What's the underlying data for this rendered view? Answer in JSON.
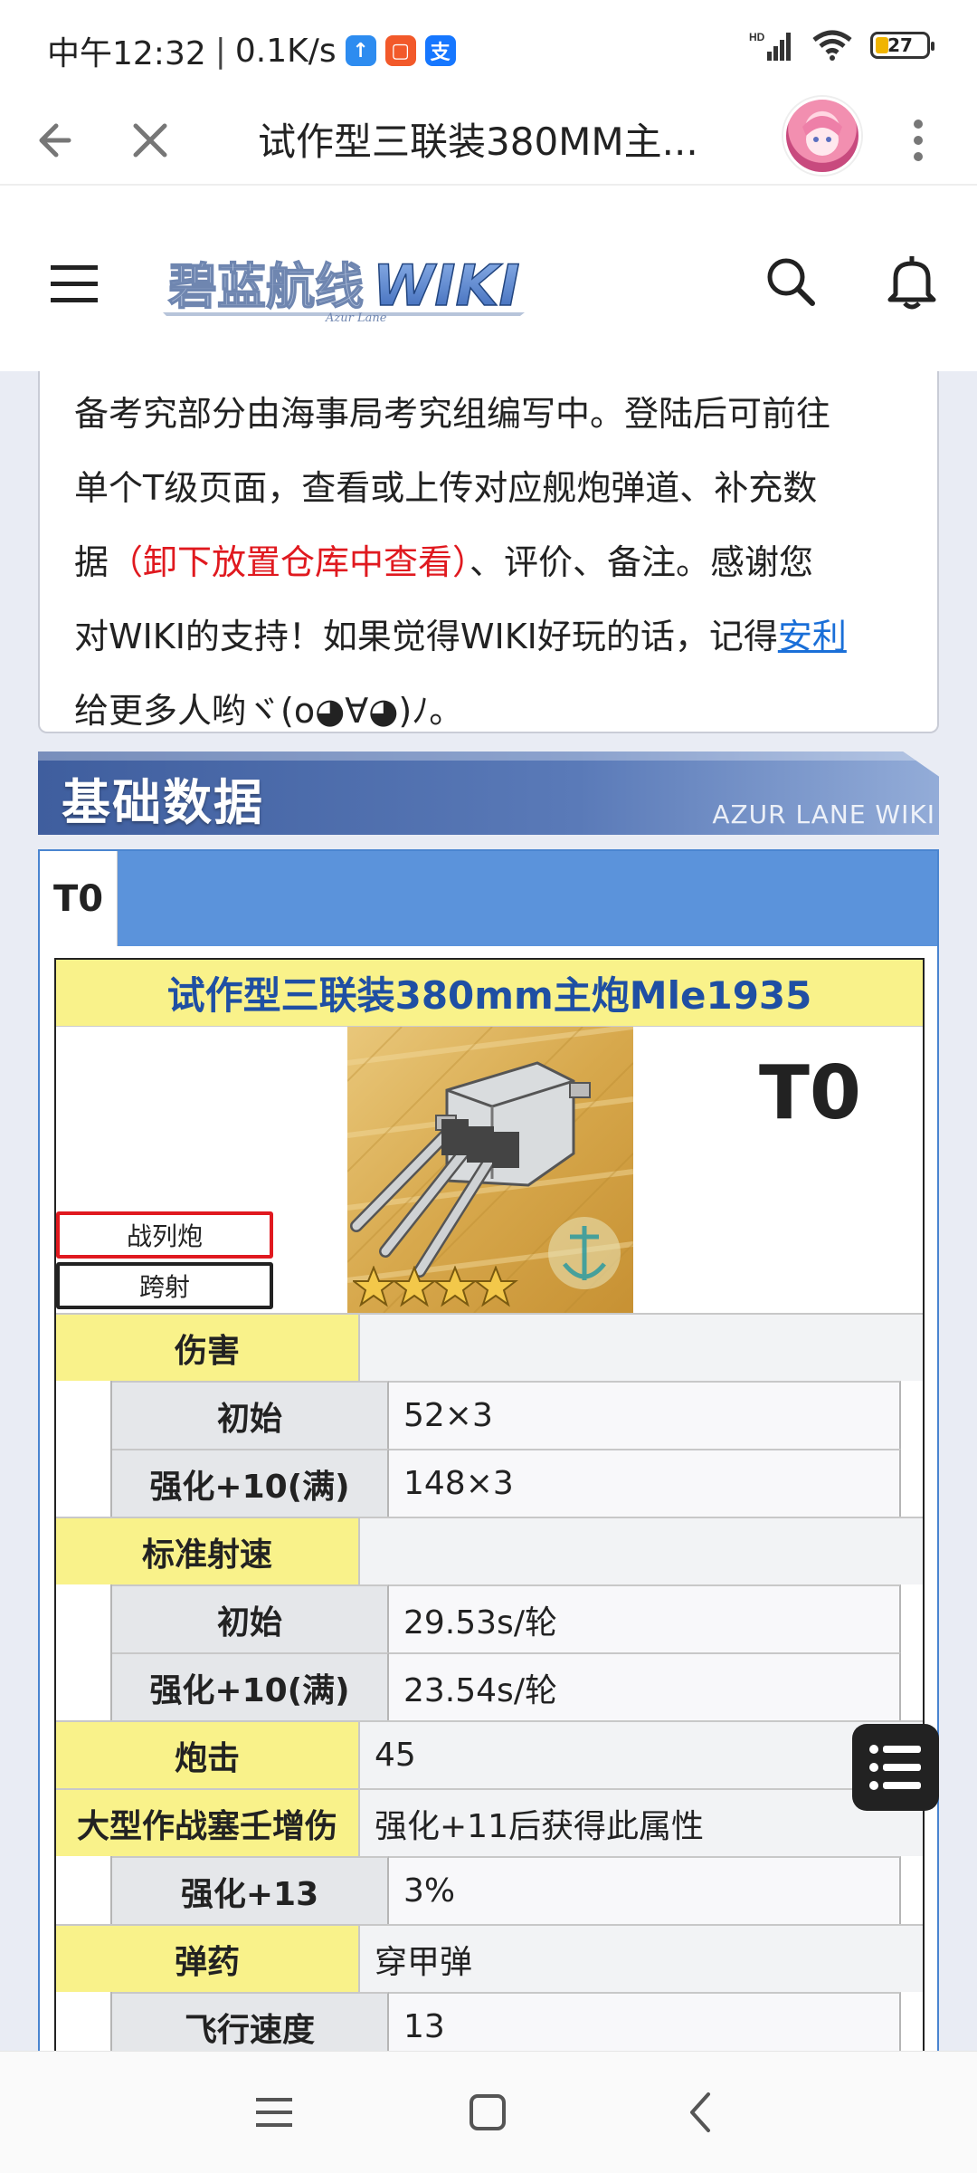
{
  "status_bar": {
    "time": "中午12:32",
    "separator": "|",
    "speed": "0.1K/s",
    "icons": [
      "upload-app-icon",
      "orange-app-icon",
      "alipay-icon"
    ],
    "signal": "HD",
    "battery": "27"
  },
  "browser": {
    "title": "试作型三联装380MM主...",
    "icons": [
      "back-arrow-icon",
      "close-icon",
      "avatar",
      "more-vert-icon"
    ]
  },
  "site": {
    "logo_text": "碧蓝航线WIKI",
    "logo_sub": "Azur Lane",
    "icons": [
      "hamburger-menu-icon",
      "search-icon",
      "bell-icon"
    ]
  },
  "notice": {
    "line1": "备考究部分由海事局考究组编写中。登陆后可前往",
    "line2": "单个T级页面，查看或上传对应舰炮弹道、补充数",
    "line3_a": "据",
    "line3_red": "（卸下放置仓库中查看）",
    "line3_b": "、评价、备注。感谢您",
    "line4_a": "对WIKI的支持！如果觉得WIKI好玩的话，记得",
    "line4_link": "安利",
    "line5": "给更多人哟ヾ(o◕∀◕)ﾉ。"
  },
  "section": {
    "title": "基础数据",
    "watermark": "AZUR LANE WIKI"
  },
  "tabs": [
    {
      "label": "T0",
      "active": true
    }
  ],
  "equipment": {
    "name": "试作型三联装380mm主炮Mle1935",
    "tier": "T0",
    "tag_type": "战列炮",
    "tag_range": "跨射",
    "stars": 4,
    "stats": {
      "damage_label": "伤害",
      "damage_init_label": "初始",
      "damage_init": "52×3",
      "damage_max_label": "强化+10(满)",
      "damage_max": "148×3",
      "rate_label": "标准射速",
      "rate_init_label": "初始",
      "rate_init": "29.53s/轮",
      "rate_max_label": "强化+10(满)",
      "rate_max": "23.54s/轮",
      "firepower_label": "炮击",
      "firepower": "45",
      "siege_label": "大型作战塞壬增伤",
      "siege_note": "强化+11后获得此属性",
      "siege_13_label": "强化+13",
      "siege_13": "3%",
      "ammo_label": "弹药",
      "ammo": "穿甲弹",
      "speed_label": "飞行速度",
      "speed": "13"
    }
  },
  "floating_button": "list-menu-icon",
  "nav": [
    "menu-icon",
    "home-square-icon",
    "back-chevron-icon"
  ]
}
